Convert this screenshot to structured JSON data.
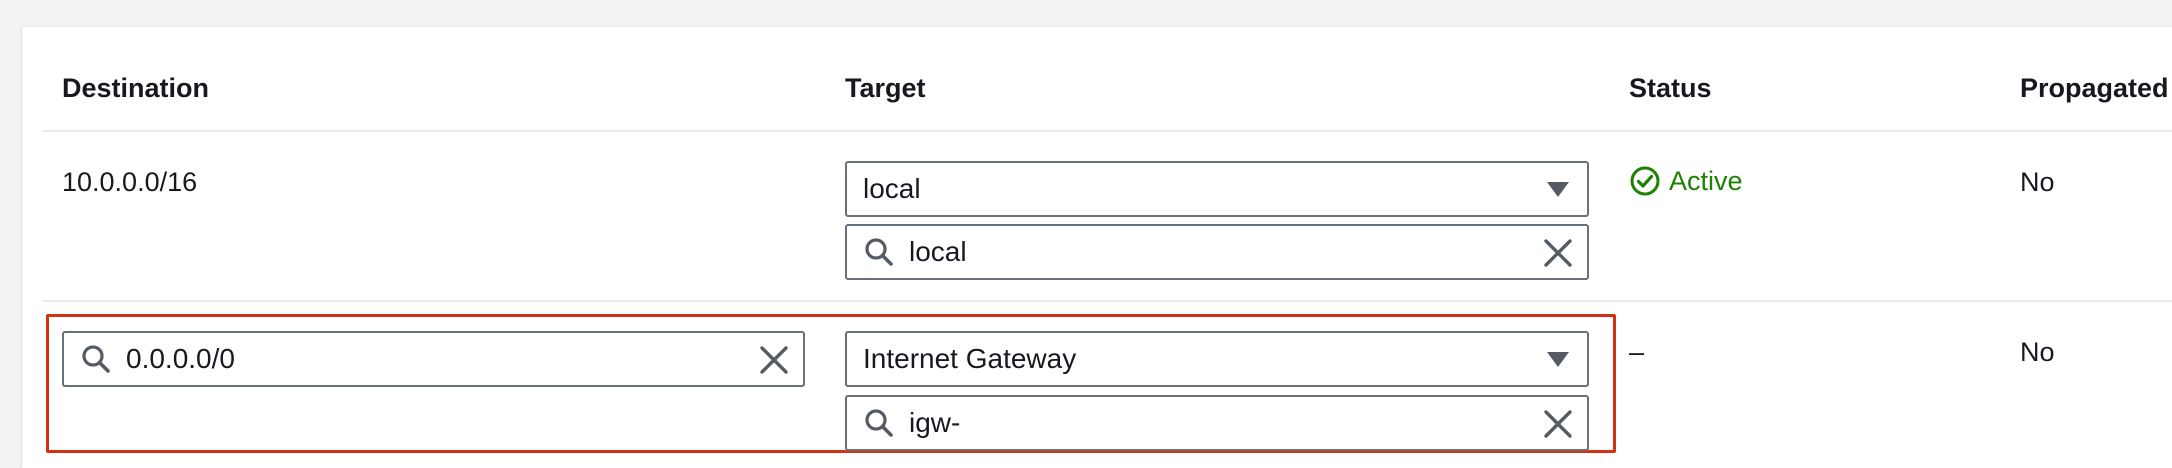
{
  "table": {
    "columns": {
      "destination": "Destination",
      "target": "Target",
      "status": "Status",
      "propagated": "Propagated"
    },
    "rows": [
      {
        "destination": "10.0.0.0/16",
        "target_select": "local",
        "target_search": "local",
        "status": "Active",
        "propagated": "No"
      },
      {
        "destination_search": "0.0.0.0/0",
        "target_select": "Internet Gateway",
        "target_search": "igw-",
        "status": "–",
        "propagated": "No"
      }
    ]
  },
  "colors": {
    "active_green": "#1d8102",
    "highlight_red": "#d13212",
    "border_gray": "#687078"
  },
  "icons": [
    "search-icon",
    "close-icon",
    "caret-down-icon",
    "status-positive-icon"
  ]
}
